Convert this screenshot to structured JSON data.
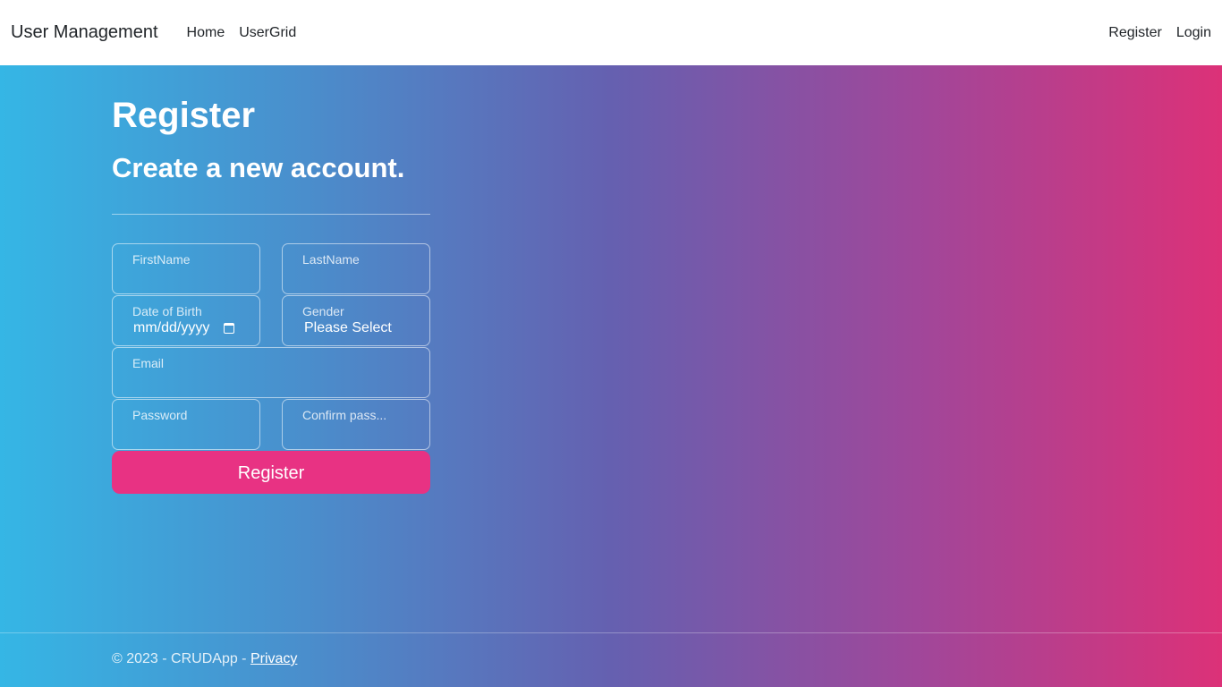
{
  "navbar": {
    "brand": "User Management",
    "left_links": [
      "Home",
      "UserGrid"
    ],
    "right_links": [
      "Register",
      "Login"
    ]
  },
  "page": {
    "title": "Register",
    "subtitle": "Create a new account."
  },
  "form": {
    "first_name_label": "FirstName",
    "last_name_label": "LastName",
    "dob_label": "Date of Birth",
    "dob_value": "mm/dd/yyyy",
    "gender_label": "Gender",
    "gender_value": "Please Select",
    "email_label": "Email",
    "password_label": "Password",
    "confirm_password_label": "Confirm pass...",
    "submit_label": "Register"
  },
  "footer": {
    "copyright": "© 2023 - CRUDApp - ",
    "privacy_link": "Privacy"
  },
  "colors": {
    "gradient_start": "#35b6e5",
    "gradient_end": "#dc3178",
    "button": "#e83283"
  }
}
